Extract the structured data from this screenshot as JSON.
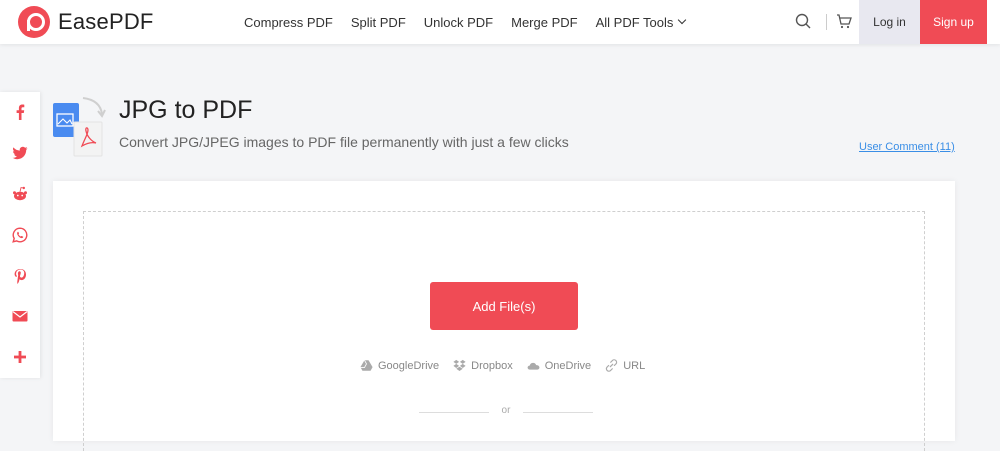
{
  "header": {
    "logo_text": "EasePDF",
    "nav": [
      "Compress PDF",
      "Split PDF",
      "Unlock PDF",
      "Merge PDF"
    ],
    "tools_label": "All PDF Tools",
    "login_label": "Log in",
    "signup_label": "Sign up"
  },
  "share": [
    "facebook-icon",
    "twitter-icon",
    "reddit-icon",
    "whatsapp-icon",
    "pinterest-icon",
    "email-icon",
    "plus-icon"
  ],
  "page": {
    "title": "JPG to PDF",
    "subtitle": "Convert JPG/JPEG images to PDF file permanently with just a few clicks",
    "user_comment": "User Comment (11)"
  },
  "upload": {
    "add_label": "Add File(s)",
    "sources": [
      "GoogleDrive",
      "Dropbox",
      "OneDrive",
      "URL"
    ],
    "or_label": "or"
  },
  "colors": {
    "brand": "#f04b55",
    "link": "#3a8ee6"
  }
}
